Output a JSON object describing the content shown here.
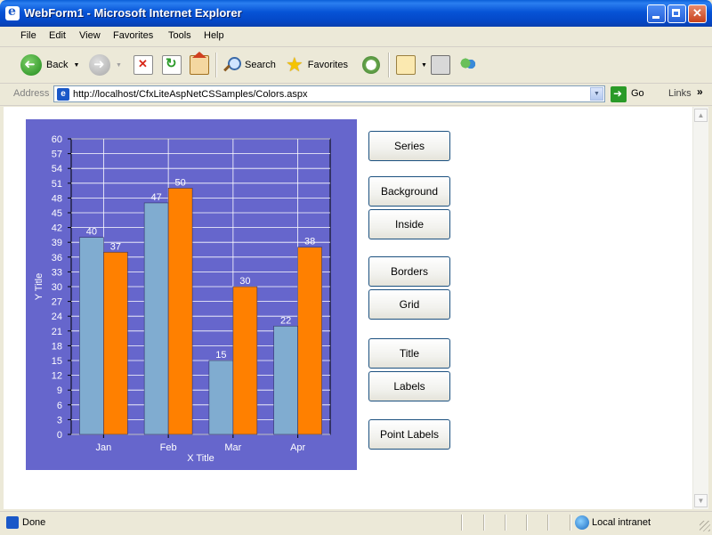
{
  "window": {
    "title": "WebForm1 - Microsoft Internet Explorer"
  },
  "menu": [
    "File",
    "Edit",
    "View",
    "Favorites",
    "Tools",
    "Help"
  ],
  "toolbar": {
    "back": "Back",
    "search": "Search",
    "favorites": "Favorites"
  },
  "address": {
    "label": "Address",
    "url": "http://localhost/CfxLiteAspNetCSSamples/Colors.aspx",
    "go": "Go",
    "links": "Links"
  },
  "status": {
    "text": "Done",
    "zone": "Local intranet"
  },
  "buttons": [
    "Series",
    "Background",
    "Inside",
    "Borders",
    "Grid",
    "Title",
    "Labels",
    "Point Labels"
  ],
  "chart_data": {
    "type": "bar",
    "categories": [
      "Jan",
      "Feb",
      "Mar",
      "Apr"
    ],
    "series": [
      {
        "values": [
          40,
          47,
          15,
          22
        ],
        "color": "#80acd0"
      },
      {
        "values": [
          37,
          50,
          30,
          38
        ],
        "color": "#ff8000"
      }
    ],
    "xlabel": "X Title",
    "ylabel": "Y Title",
    "ylim": [
      0,
      60
    ],
    "ytick_step": 3,
    "grid": true,
    "background_color": "#6666cc",
    "data_labels": true
  }
}
